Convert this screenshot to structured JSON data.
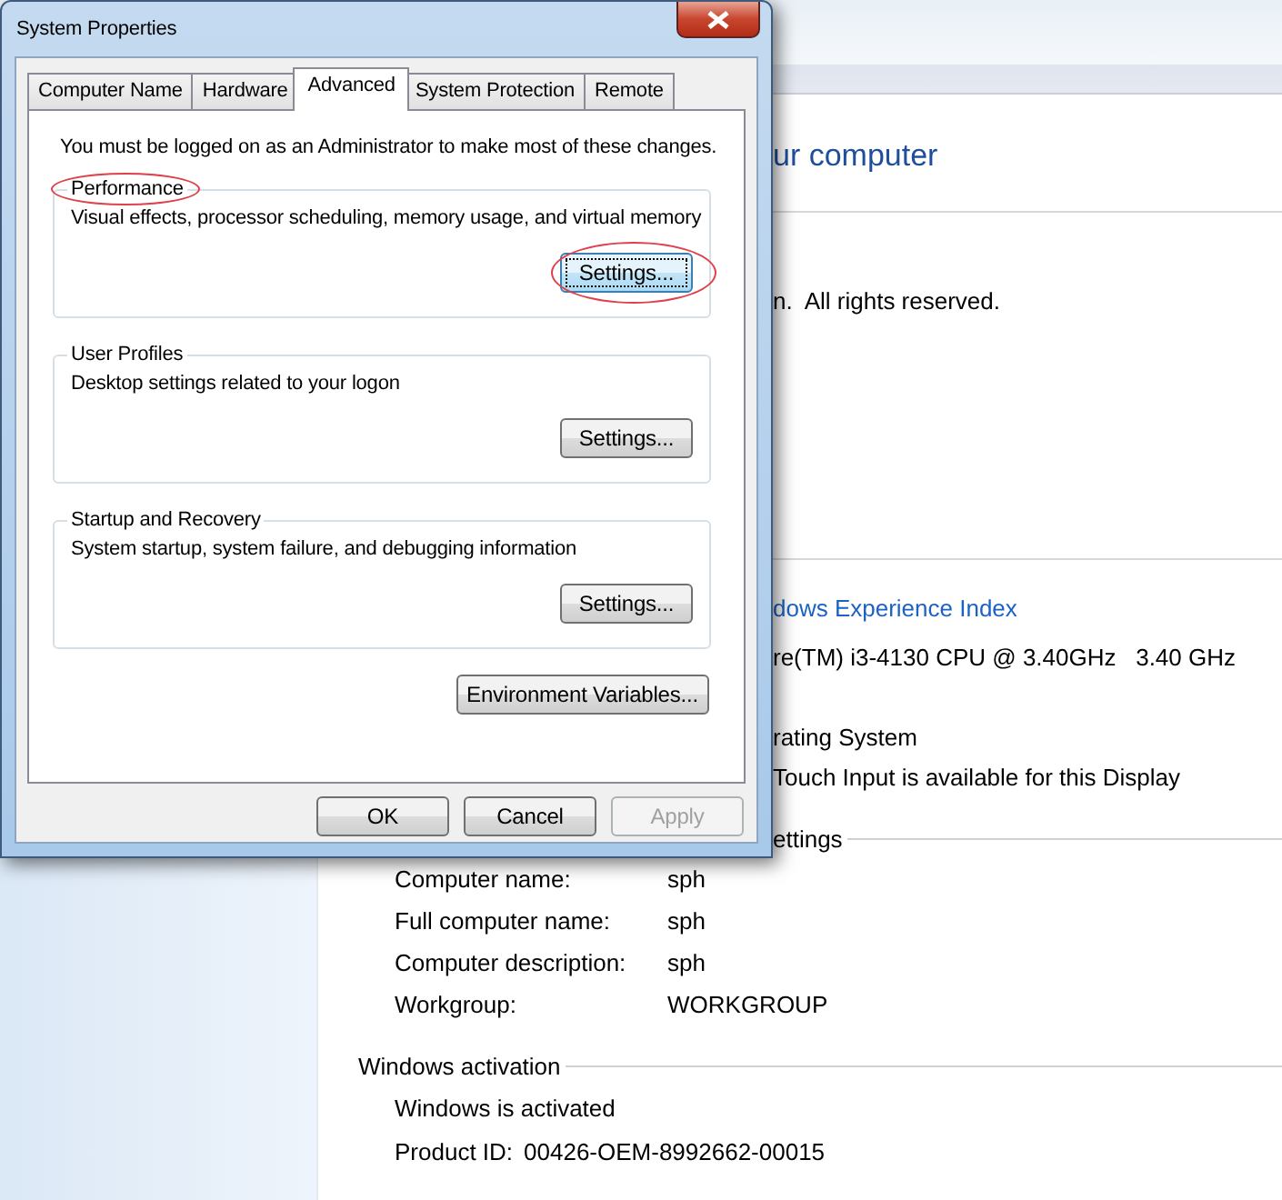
{
  "window": {
    "title": "System Properties"
  },
  "tabs": [
    {
      "label": "Computer Name",
      "selected": false
    },
    {
      "label": "Hardware",
      "selected": false
    },
    {
      "label": "Advanced",
      "selected": true
    },
    {
      "label": "System Protection",
      "selected": false
    },
    {
      "label": "Remote",
      "selected": false
    }
  ],
  "notice": "You must be logged on as an Administrator to make most of these changes.",
  "groups": [
    {
      "title": "Performance",
      "description": "Visual effects, processor scheduling, memory usage, and virtual memory",
      "button": "Settings...",
      "focused": true,
      "circled": true
    },
    {
      "title": "User Profiles",
      "description": "Desktop settings related to your logon",
      "button": "Settings...",
      "focused": false,
      "circled": false
    },
    {
      "title": "Startup and Recovery",
      "description": "System startup, system failure, and debugging information",
      "button": "Settings...",
      "focused": false,
      "circled": false
    }
  ],
  "environment_button": "Environment Variables...",
  "buttons": [
    {
      "label": "OK",
      "disabled": false
    },
    {
      "label": "Cancel",
      "disabled": false
    },
    {
      "label": "Apply",
      "disabled": true
    }
  ],
  "background_window": {
    "blocks": [
      [
        {
          "kind": "title",
          "text": "ur computer"
        }
      ],
      [
        {
          "kind": "text",
          "text": "n.  All rights reserved."
        }
      ],
      [
        {
          "kind": "link",
          "text": "dows Experience Index"
        },
        {
          "kind": "text",
          "text": "re(TM) i3-4130 CPU @ 3.40GHz   3.40 GHz"
        }
      ],
      [
        {
          "kind": "text",
          "text": "rating System"
        },
        {
          "kind": "text",
          "text": "Touch Input is available for this Display"
        }
      ]
    ],
    "sections": [
      {
        "title": "ettings",
        "kind": "clipped",
        "rows": [
          {
            "label": "Computer name:",
            "value": "sph"
          },
          {
            "label": "Full computer name:",
            "value": "sph"
          },
          {
            "label": "Computer description:",
            "value": "sph"
          },
          {
            "label": "Workgroup:",
            "value": "WORKGROUP"
          }
        ]
      },
      {
        "title": "Windows activation",
        "kind": "full",
        "rows": [
          {
            "text": "Windows is activated"
          },
          {
            "label": "Product ID:",
            "value": "00426-OEM-8992662-00015",
            "kind": "inline"
          }
        ]
      }
    ]
  }
}
